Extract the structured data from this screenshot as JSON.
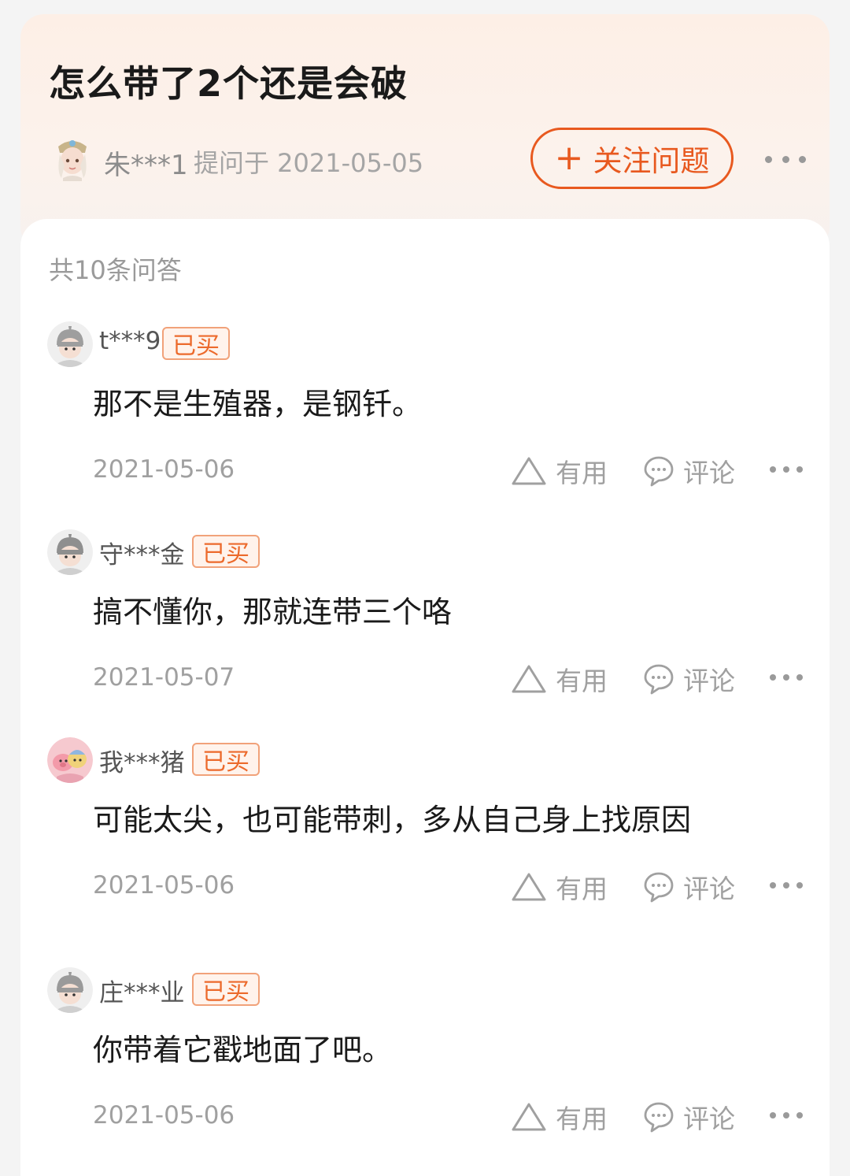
{
  "question": {
    "title": "怎么带了2个还是会破",
    "asker": "朱***1",
    "asked_at": "提问于 2021-05-05",
    "follow_label": "关注问题",
    "follow_icon": "plus-icon",
    "accent_color": "#e8591f"
  },
  "answers_section": {
    "count_label": "共10条问答",
    "useful_label": "有用",
    "comment_label": "评论",
    "bought_label": "已买",
    "items": [
      {
        "user": "t***9",
        "text": "那不是生殖器，是钢钎。",
        "date": "2021-05-06"
      },
      {
        "user": "守***金",
        "text": "搞不懂你，那就连带三个咯",
        "date": "2021-05-07"
      },
      {
        "user": "我***猪",
        "text": "可能太尖，也可能带刺，多从自己身上找原因",
        "date": "2021-05-06"
      },
      {
        "user": "庄***业",
        "text": "你带着它戳地面了吧。",
        "date": "2021-05-06"
      }
    ]
  }
}
